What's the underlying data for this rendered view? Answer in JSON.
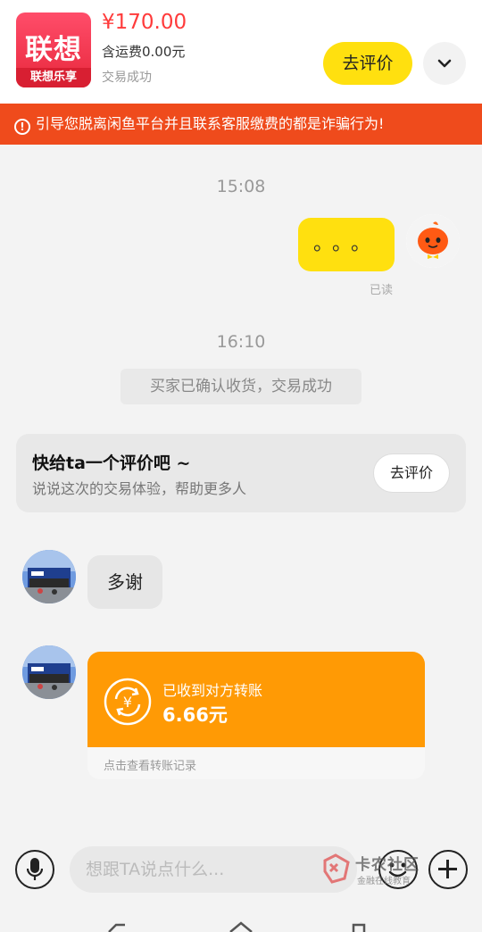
{
  "product": {
    "thumb_brand_big": "联想",
    "thumb_brand_small": "联想乐享",
    "price": "¥170.00",
    "shipping": "含运费0.00元",
    "status": "交易成功",
    "review_button": "去评价"
  },
  "warning": {
    "text": "引导您脱离闲鱼平台并且联系客服缴费的都是诈骗行为!",
    "icon": "exclamation-circle-icon"
  },
  "chat": {
    "time1": "15:08",
    "my_message": "。。。",
    "read_status": "已读",
    "time2": "16:10",
    "system_message": "买家已确认收货，交易成功",
    "review_card": {
      "title": "快给ta一个评价吧 ~",
      "subtitle": "说说这次的交易体验，帮助更多人",
      "button": "去评价"
    },
    "other_message": "多谢",
    "transfer": {
      "label": "已收到对方转账",
      "amount": "6.66元",
      "footer": "点击查看转账记录",
      "icon": "yuan-exchange-icon"
    }
  },
  "input": {
    "placeholder": "想跟TA说点什么..."
  },
  "watermark": {
    "name": "卡农社区",
    "sub": "金融在线教育"
  },
  "colors": {
    "accent_yellow": "#ffe00f",
    "price_red": "#ff3b3b",
    "warning_bg": "#ef4b1c",
    "transfer_orange": "#ff9a05"
  }
}
